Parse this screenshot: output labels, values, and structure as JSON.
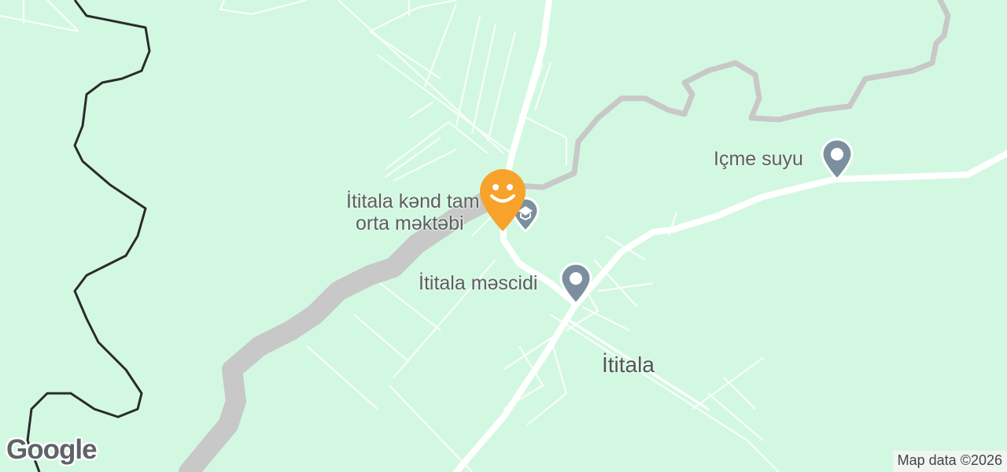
{
  "map": {
    "pois": [
      {
        "name": "İtitala kənd tam",
        "name_line2": "orta məktəbi",
        "icon": "school-icon"
      },
      {
        "name": "İtitala məscidi",
        "icon": "place-pin-icon"
      },
      {
        "name": "Içme suyu",
        "icon": "place-pin-icon"
      }
    ],
    "town": "İtitala",
    "marker_icon": "smiley-marker-icon",
    "attribution": "Map data ©2026",
    "logo": "Google",
    "colors": {
      "land": "#d3f8e2",
      "river": "#c8c8c8",
      "road": "#ffffff",
      "border": "#2b2b2b",
      "marker": "#f7a22b",
      "poi_pin": "#7b8f9e"
    }
  }
}
